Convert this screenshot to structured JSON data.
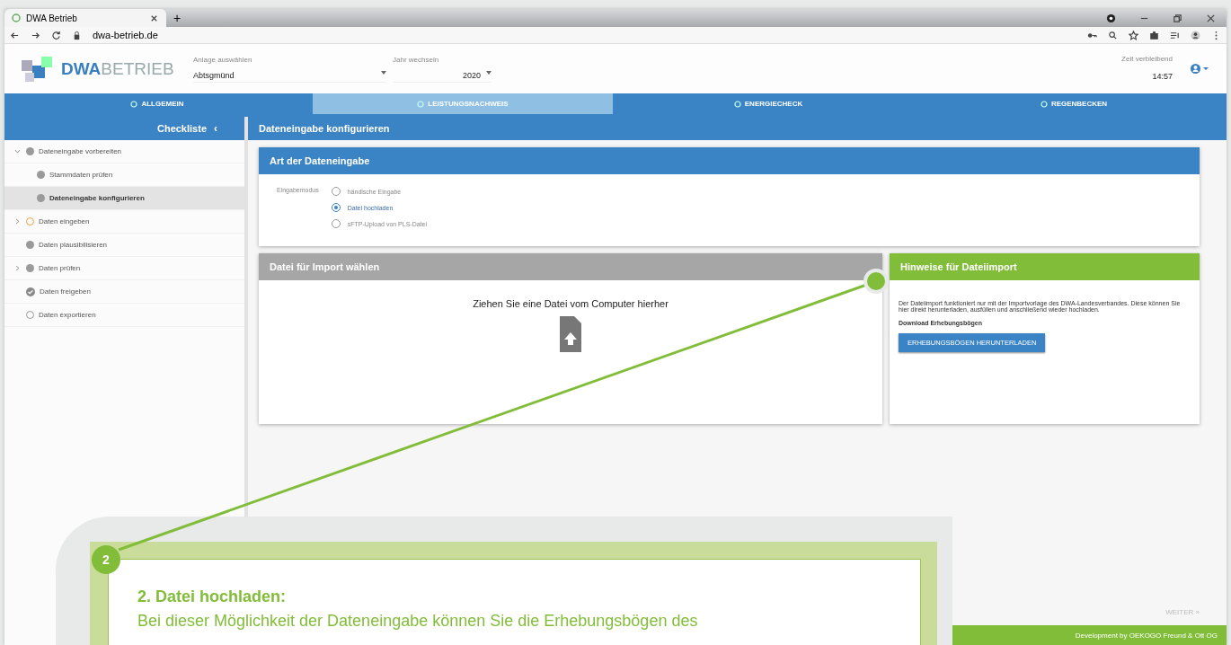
{
  "browser": {
    "tab_title": "DWA Betrieb",
    "new_tab": "+",
    "url": "dwa-betrieb.de"
  },
  "header": {
    "logo_bold": "DWA",
    "logo_light": "BETRIEB",
    "plant_label": "Anlage auswählen",
    "plant_value": "Abtsgmünd",
    "year_label": "Jahr wechseln",
    "year_value": "2020",
    "time_label": "Zeit verbleibend",
    "time_value": "14:57"
  },
  "nav_tabs": [
    {
      "label": "ALLGEMEIN",
      "selected": false
    },
    {
      "label": "LEISTUNGSNACHWEIS",
      "selected": true
    },
    {
      "label": "ENERGIECHECK",
      "selected": false
    },
    {
      "label": "REGENBECKEN",
      "selected": false
    }
  ],
  "sidebar": {
    "title": "Checkliste",
    "collapse": "‹",
    "items": [
      {
        "label": "Dateneingabe vorbereiten",
        "kind": "done",
        "expanded": true,
        "selected": false,
        "children": [
          {
            "label": "Stammdaten prüfen",
            "kind": "done",
            "selected": false
          },
          {
            "label": "Dateneingabe konfigurieren",
            "kind": "done",
            "selected": true
          }
        ]
      },
      {
        "label": "Daten eingeben",
        "kind": "current",
        "expanded": false,
        "selected": false
      },
      {
        "label": "Daten plausibilisieren",
        "kind": "done",
        "selected": false
      },
      {
        "label": "Daten prüfen",
        "kind": "done",
        "expanded": false,
        "selected": false
      },
      {
        "label": "Daten freigeben",
        "kind": "checked",
        "selected": false
      },
      {
        "label": "Daten exportieren",
        "kind": "empty",
        "selected": false
      }
    ]
  },
  "content": {
    "title": "Dateneingabe konfigurieren",
    "mode_card": {
      "title": "Art der Dateneingabe",
      "field_label": "Eingabemodus",
      "options": [
        {
          "label": "händische Eingabe",
          "selected": false
        },
        {
          "label": "Datei hochladen",
          "selected": true
        },
        {
          "label": "sFTP-Upload von PLS-Datei",
          "selected": false
        }
      ]
    },
    "import_card": {
      "title": "Datei für Import wählen",
      "drop_text": "Ziehen Sie eine Datei vom Computer hierher"
    },
    "hints_card": {
      "title": "Hinweise für Dateiimport",
      "text": "Der Dateiimport funktioniert nur mit der Importvorlage des DWA-Landesverbandes. Diese können Sie hier direkt herunterladen, ausfüllen und anschließend wieder hochladen.",
      "download_label": "Download Erhebungsbögen",
      "button": "ERHEBUNGSBÖGEN HERUNTERLADEN"
    },
    "next_button": "WEITER »"
  },
  "footer": {
    "credit": "Development by OEKOGO Freund & Ott OG"
  },
  "callout": {
    "number": "2",
    "title": "2. Datei hochladen:",
    "text": "Bei dieser Möglichkeit der Dateneingabe können Sie die Erhebungsbögen des"
  }
}
